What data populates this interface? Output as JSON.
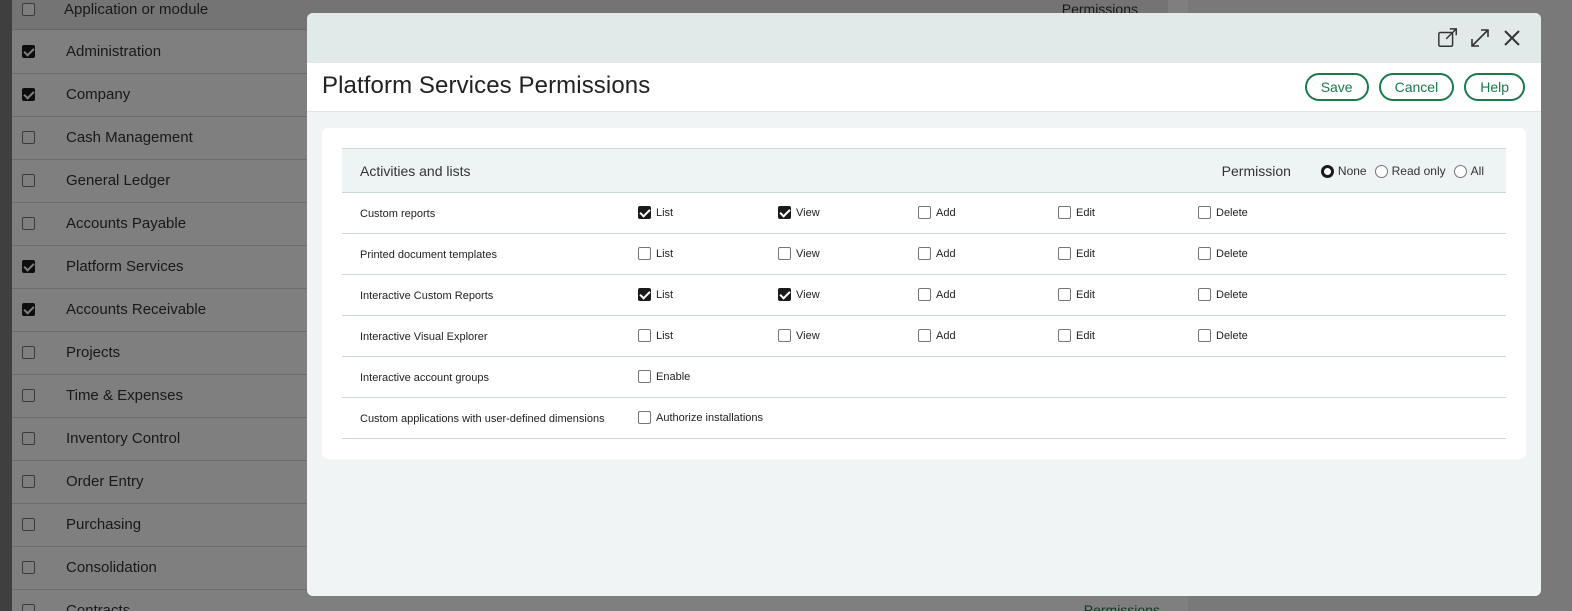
{
  "background": {
    "header": {
      "title": "Application or module",
      "permissions": "Permissions"
    },
    "rows": [
      {
        "label": "Administration",
        "checked": true
      },
      {
        "label": "Company",
        "checked": true
      },
      {
        "label": "Cash Management",
        "checked": false
      },
      {
        "label": "General Ledger",
        "checked": false
      },
      {
        "label": "Accounts Payable",
        "checked": false
      },
      {
        "label": "Platform Services",
        "checked": true
      },
      {
        "label": "Accounts Receivable",
        "checked": true
      },
      {
        "label": "Projects",
        "checked": false
      },
      {
        "label": "Time & Expenses",
        "checked": false
      },
      {
        "label": "Inventory Control",
        "checked": false
      },
      {
        "label": "Order Entry",
        "checked": false
      },
      {
        "label": "Purchasing",
        "checked": false
      },
      {
        "label": "Consolidation",
        "checked": false
      },
      {
        "label": "Contracts",
        "checked": false
      }
    ],
    "permissions_link": "Permissions"
  },
  "modal": {
    "title": "Platform Services Permissions",
    "buttons": {
      "save": "Save",
      "cancel": "Cancel",
      "help": "Help"
    },
    "icons": [
      "open-new-window-icon",
      "expand-icon",
      "close-icon"
    ],
    "table": {
      "header_title": "Activities and lists",
      "permission_label": "Permission",
      "radio_options": [
        {
          "label": "None",
          "selected": true
        },
        {
          "label": "Read only",
          "selected": false
        },
        {
          "label": "All",
          "selected": false
        }
      ],
      "rows": [
        {
          "name": "Custom reports",
          "options": [
            {
              "label": "List",
              "checked": true
            },
            {
              "label": "View",
              "checked": true
            },
            {
              "label": "Add",
              "checked": false
            },
            {
              "label": "Edit",
              "checked": false
            },
            {
              "label": "Delete",
              "checked": false
            }
          ]
        },
        {
          "name": "Printed document templates",
          "options": [
            {
              "label": "List",
              "checked": false
            },
            {
              "label": "View",
              "checked": false
            },
            {
              "label": "Add",
              "checked": false
            },
            {
              "label": "Edit",
              "checked": false
            },
            {
              "label": "Delete",
              "checked": false
            }
          ]
        },
        {
          "name": "Interactive Custom Reports",
          "options": [
            {
              "label": "List",
              "checked": true
            },
            {
              "label": "View",
              "checked": true
            },
            {
              "label": "Add",
              "checked": false
            },
            {
              "label": "Edit",
              "checked": false
            },
            {
              "label": "Delete",
              "checked": false
            }
          ]
        },
        {
          "name": "Interactive Visual Explorer",
          "options": [
            {
              "label": "List",
              "checked": false
            },
            {
              "label": "View",
              "checked": false
            },
            {
              "label": "Add",
              "checked": false
            },
            {
              "label": "Edit",
              "checked": false
            },
            {
              "label": "Delete",
              "checked": false
            }
          ]
        },
        {
          "name": "Interactive account groups",
          "options": [
            {
              "label": "Enable",
              "checked": false
            }
          ]
        },
        {
          "name": "Custom applications with user-defined dimensions",
          "options": [
            {
              "label": "Authorize installations",
              "checked": false
            }
          ]
        }
      ]
    }
  },
  "colors": {
    "accent": "#1a7a4c",
    "modal_bg": "#f0f4f4",
    "modal_top": "#e2e9e9"
  }
}
